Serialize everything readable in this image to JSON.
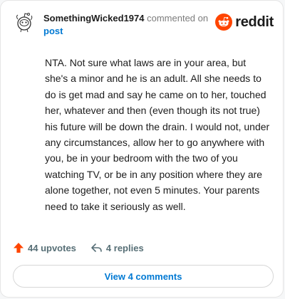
{
  "comment": {
    "author": "SomethingWicked1974",
    "action": "commented on",
    "target": "post",
    "body": "NTA. Not sure what laws are in your area, but she's a minor and he is an adult. All she needs to do is get mad and say he came on to her, touched her, whatever and then (even though its not true) his future will be down the drain. I would not, under any circumstances, allow her to go anywhere with you, be in your bedroom with the two of you watching TV, or be in any position where they are alone together, not even 5 minutes. Your parents need to take it seriously as well."
  },
  "brand": {
    "wordmark": "reddit",
    "color": "#ff4500"
  },
  "stats": {
    "upvotes": "44 upvotes",
    "replies": "4 replies",
    "upvote_color": "#ff4500"
  },
  "actions": {
    "view_comments": "View 4 comments"
  },
  "icons": {
    "avatar": "snoo-avatar-icon",
    "brand": "reddit-logo-icon",
    "upvote": "upvote-arrow-icon",
    "reply": "reply-arrow-icon"
  }
}
